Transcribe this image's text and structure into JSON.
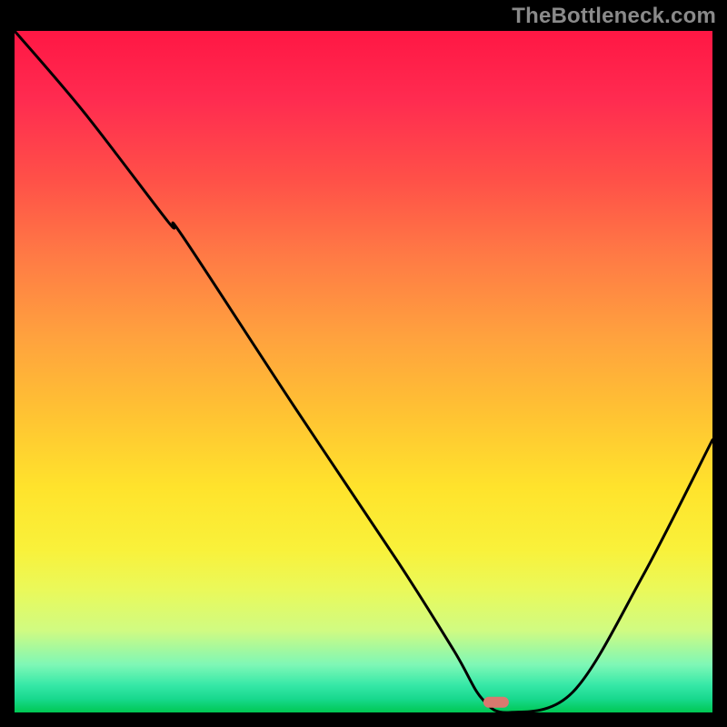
{
  "watermark": "TheBottleneck.com",
  "chart_data": {
    "type": "line",
    "title": "",
    "xlabel": "",
    "ylabel": "",
    "xlim": [
      0,
      100
    ],
    "ylim": [
      0,
      100
    ],
    "x": [
      0,
      10,
      22,
      24,
      40,
      55,
      63,
      67,
      71,
      80,
      90,
      100
    ],
    "values": [
      100,
      88,
      72,
      70,
      45,
      22,
      9,
      2,
      0,
      3,
      20,
      40
    ],
    "marker": {
      "x": 69,
      "y": 1.5
    },
    "colors": {
      "background_top": "#ff1744",
      "background_bottom": "#00c853",
      "curve": "#000000",
      "marker": "#d9796f",
      "frame": "#000000"
    }
  }
}
